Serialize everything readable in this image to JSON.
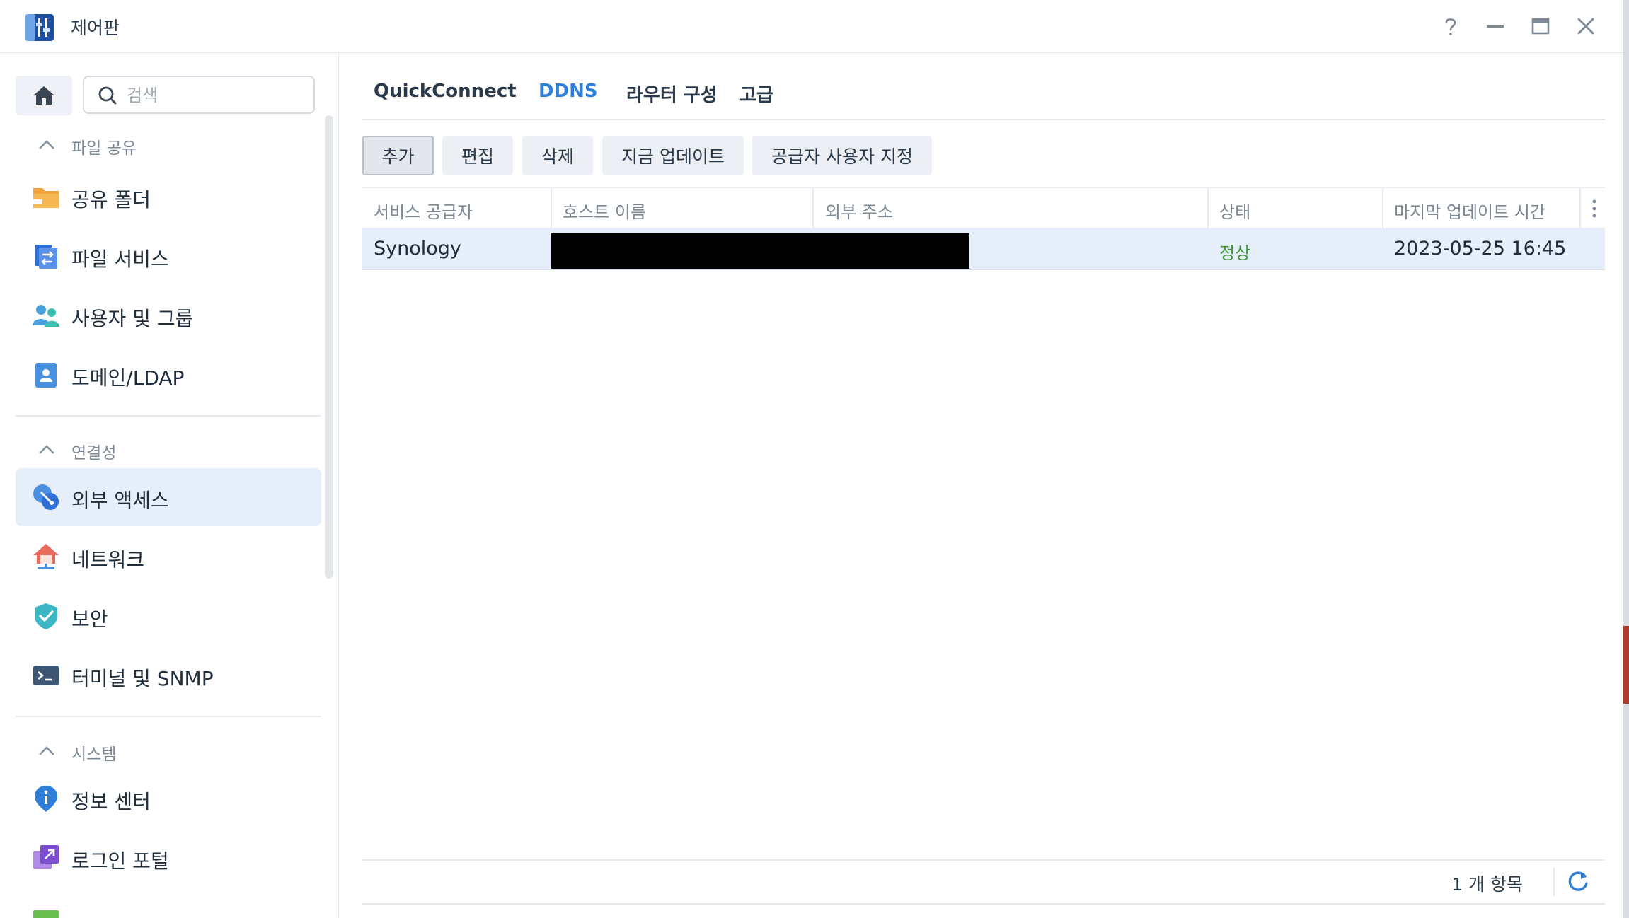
{
  "window": {
    "title": "제어판",
    "icon": "control-panel-icon",
    "controls": [
      "help-icon",
      "minimize-icon",
      "maximize-icon",
      "close-icon"
    ]
  },
  "sidebar": {
    "search_placeholder": "검색",
    "groups": [
      {
        "label": "파일 공유",
        "items": [
          {
            "label": "공유 폴더",
            "icon": "shared-folder-icon"
          },
          {
            "label": "파일 서비스",
            "icon": "file-services-icon"
          },
          {
            "label": "사용자 및 그룹",
            "icon": "users-groups-icon"
          },
          {
            "label": "도메인/LDAP",
            "icon": "domain-ldap-icon"
          }
        ]
      },
      {
        "label": "연결성",
        "items": [
          {
            "label": "외부 액세스",
            "icon": "external-access-icon",
            "active": true
          },
          {
            "label": "네트워크",
            "icon": "network-icon"
          },
          {
            "label": "보안",
            "icon": "security-shield-icon"
          },
          {
            "label": "터미널 및 SNMP",
            "icon": "terminal-icon"
          }
        ]
      },
      {
        "label": "시스템",
        "items": [
          {
            "label": "정보 센터",
            "icon": "info-center-icon"
          },
          {
            "label": "로그인 포털",
            "icon": "login-portal-icon"
          }
        ]
      }
    ]
  },
  "tabs": [
    {
      "label": "QuickConnect",
      "active": false
    },
    {
      "label": "DDNS",
      "active": true
    },
    {
      "label": "라우터 구성",
      "active": false
    },
    {
      "label": "고급",
      "active": false
    }
  ],
  "toolbar": {
    "add": "추가",
    "edit": "편집",
    "delete": "삭제",
    "update_now": "지금 업데이트",
    "customize_provider": "공급자 사용자 지정"
  },
  "table": {
    "columns": [
      "서비스 공급자",
      "호스트 이름",
      "외부 주소",
      "상태",
      "마지막 업데이트 시간"
    ],
    "rows": [
      {
        "provider": "Synology",
        "hostname": "",
        "external_address": "",
        "status": "정상",
        "last_update": "2023-05-25 16:45"
      }
    ]
  },
  "footer": {
    "count_label": "1 개 항목"
  },
  "colors": {
    "accent": "#2f7fd9",
    "status_ok": "#3a9a2f",
    "selection": "#e6eef9"
  }
}
